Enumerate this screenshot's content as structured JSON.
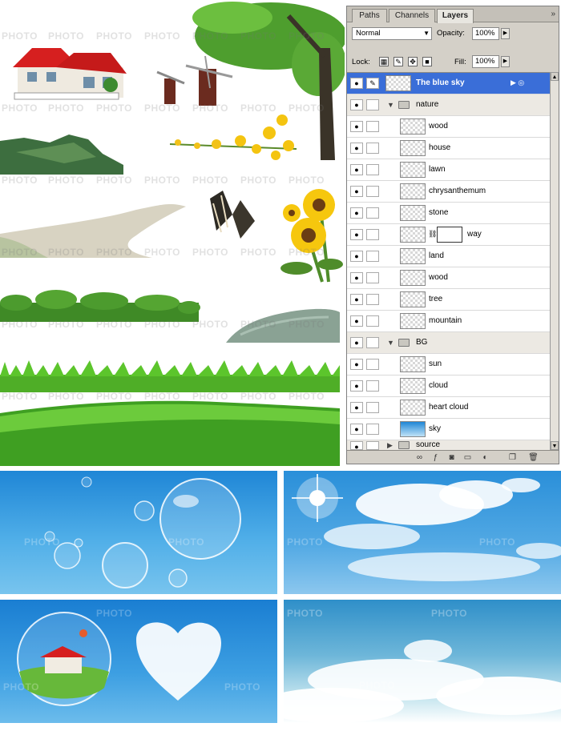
{
  "watermark": "PHOTO",
  "colors": {
    "selection": "#3a6ed8",
    "panel_bg": "#d4d0c8",
    "sky_blue": "#1f86d6"
  },
  "panel": {
    "tabs": [
      {
        "label": "Paths",
        "active": false
      },
      {
        "label": "Channels",
        "active": false
      },
      {
        "label": "Layers",
        "active": true
      }
    ],
    "menu_icon": "»",
    "blend_mode": "Normal",
    "opacity_label": "Opacity:",
    "opacity_value": "100%",
    "lock_label": "Lock:",
    "fill_label": "Fill:",
    "fill_value": "100%",
    "layers": [
      {
        "name": "The blue sky",
        "type": "layer",
        "selected": true
      },
      {
        "name": "nature",
        "type": "group"
      },
      {
        "name": "wood",
        "type": "layer"
      },
      {
        "name": "house",
        "type": "layer"
      },
      {
        "name": "lawn",
        "type": "layer"
      },
      {
        "name": "chrysanthemum",
        "type": "layer"
      },
      {
        "name": "stone",
        "type": "layer"
      },
      {
        "name": "way",
        "type": "layer",
        "mask": true
      },
      {
        "name": "land",
        "type": "layer"
      },
      {
        "name": "wood",
        "type": "layer"
      },
      {
        "name": "tree",
        "type": "layer"
      },
      {
        "name": "mountain",
        "type": "layer"
      },
      {
        "name": "BG",
        "type": "group"
      },
      {
        "name": "sun",
        "type": "layer"
      },
      {
        "name": "cloud",
        "type": "layer"
      },
      {
        "name": "heart cloud",
        "type": "layer"
      },
      {
        "name": "sky",
        "type": "layer"
      },
      {
        "name": "source",
        "type": "group",
        "collapsed": true
      }
    ],
    "bottom_icons": [
      "link-icon",
      "layer-style-icon",
      "mask-icon",
      "new-group-icon",
      "adjustment-icon",
      "new-layer-icon",
      "trash-icon"
    ]
  },
  "clipart": [
    "house",
    "windmills",
    "tree",
    "mountain",
    "yellow-flowers",
    "butterfly",
    "sunflowers",
    "path",
    "shrubs",
    "stone",
    "grass",
    "lawn"
  ],
  "backgrounds": [
    "bubbles",
    "sun-sky",
    "heart-cloud-bubble",
    "soft-sky"
  ]
}
